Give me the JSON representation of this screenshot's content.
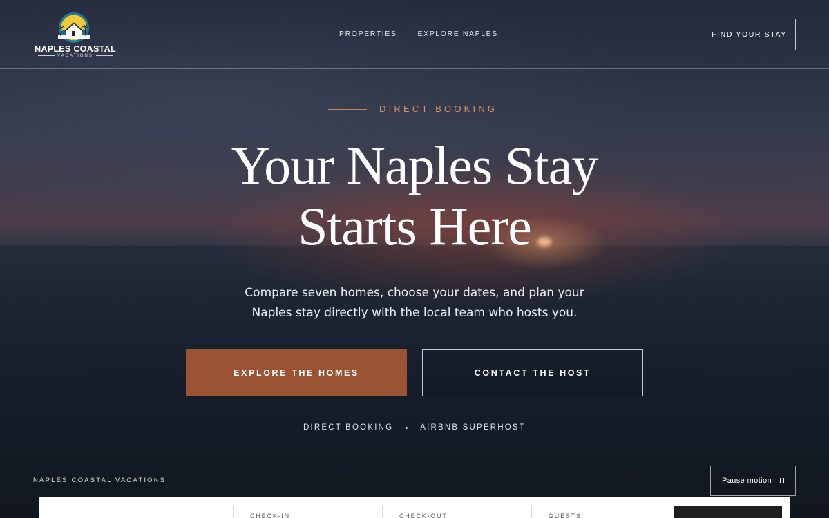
{
  "header": {
    "logo_name": "NAPLES COASTAL",
    "logo_sub": "VACATIONS",
    "nav": [
      {
        "label": "PROPERTIES"
      },
      {
        "label": "EXPLORE NAPLES"
      }
    ],
    "cta_label": "FIND YOUR STAY"
  },
  "hero": {
    "eyebrow": "DIRECT BOOKING",
    "headline_line1": "Your Naples Stay",
    "headline_line2": "Starts Here",
    "subcopy": "Compare seven homes, choose your dates, and plan your Naples stay directly with the local team who hosts you.",
    "primary_label": "EXPLORE THE HOMES",
    "secondary_label": "CONTACT THE HOST",
    "trust": [
      "DIRECT BOOKING",
      "AIRBNB SUPERHOST"
    ]
  },
  "footer": {
    "brand_caption": "NAPLES COASTAL VACATIONS",
    "pause_label": "Pause motion"
  },
  "booking": {
    "checkin_label": "CHECK-IN",
    "checkout_label": "CHECK-OUT",
    "guests_label": "GUESTS"
  },
  "colors": {
    "accent": "#9a5434",
    "eyebrow": "#d39467",
    "sky": "#2c3347",
    "sea": "#1c2432"
  },
  "icons": [
    "logo-mark",
    "pause-icon"
  ]
}
